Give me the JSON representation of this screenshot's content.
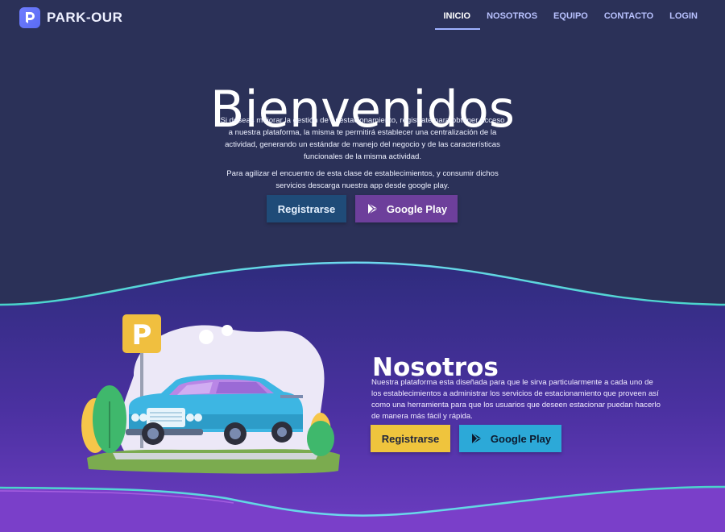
{
  "brand": {
    "name": "PARK-OUR",
    "logo_icon": "chat-bubble-p-icon",
    "accent": "#6f7dff"
  },
  "nav": {
    "items": [
      {
        "label": "INICIO",
        "active": true
      },
      {
        "label": "NOSOTROS",
        "active": false
      },
      {
        "label": "EQUIPO",
        "active": false
      },
      {
        "label": "CONTACTO",
        "active": false
      },
      {
        "label": "LOGIN",
        "active": false
      }
    ]
  },
  "hero": {
    "title": "Bienvenidos",
    "paragraph1": "Si deseas mejorar la gestión de tu estacionamiento, registrate para obtener acceso a nuestra plataforma, la misma te permitirá establecer una centralización de la actividad, generando un estándar de manejo del negocio y de las características funcionales de la misma actividad.",
    "paragraph2": "Para agilizar el encuentro de esta clase de establecimientos, y consumir dichos servicios descarga nuestra app desde google play.",
    "register_label": "Registrarse",
    "google_label": "Google Play"
  },
  "about": {
    "title": "Nosotros",
    "text": "Nuestra plataforma esta diseñada para que le sirva particularmente a cada uno de los establecimientos a administrar los servicios de estacionamiento que proveen así como una herramienta para que los usuarios que deseen estacionar puedan hacerlo de manera más fácil y rápida.",
    "register_label": "Registrarse",
    "google_label": "Google Play",
    "illustration": {
      "sign_letter": "P",
      "sign_icon": "parking-sign-icon",
      "car_icon": "car-icon"
    }
  },
  "colors": {
    "background": "#2b3158",
    "about_top": "#322f8a",
    "about_bottom": "#6b3dbf",
    "wave_stroke": "#4fd7e0",
    "btn_register_dark": "#1f4b78",
    "btn_google_purple": "#6d3f9b",
    "btn_register_yellow": "#efc43d",
    "btn_google_blue": "#2ca9d8"
  }
}
